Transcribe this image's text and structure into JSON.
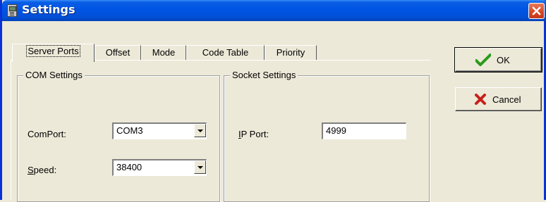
{
  "window": {
    "title": "Settings",
    "close_icon": "close-icon"
  },
  "tabs": [
    {
      "label": "Server Ports",
      "active": true
    },
    {
      "label": "Offset",
      "active": false
    },
    {
      "label": "Mode",
      "active": false
    },
    {
      "label": "Code Table",
      "active": false
    },
    {
      "label": "Priority",
      "active": false
    }
  ],
  "com_settings": {
    "title": "COM Settings",
    "comport_label": "ComPort:",
    "comport_value": "COM3",
    "speed_label_first": "S",
    "speed_label_rest": "peed:",
    "speed_value": "38400"
  },
  "socket_settings": {
    "title": "Socket Settings",
    "ip_port_label_first": "I",
    "ip_port_label_rest": "P Port:",
    "ip_port_value": "4999"
  },
  "buttons": {
    "ok_label": "OK",
    "cancel_label": "Cancel"
  },
  "colors": {
    "titlebar": "#0054e3",
    "ok_check": "#2a9a1a",
    "cancel_x": "#c8201a"
  }
}
